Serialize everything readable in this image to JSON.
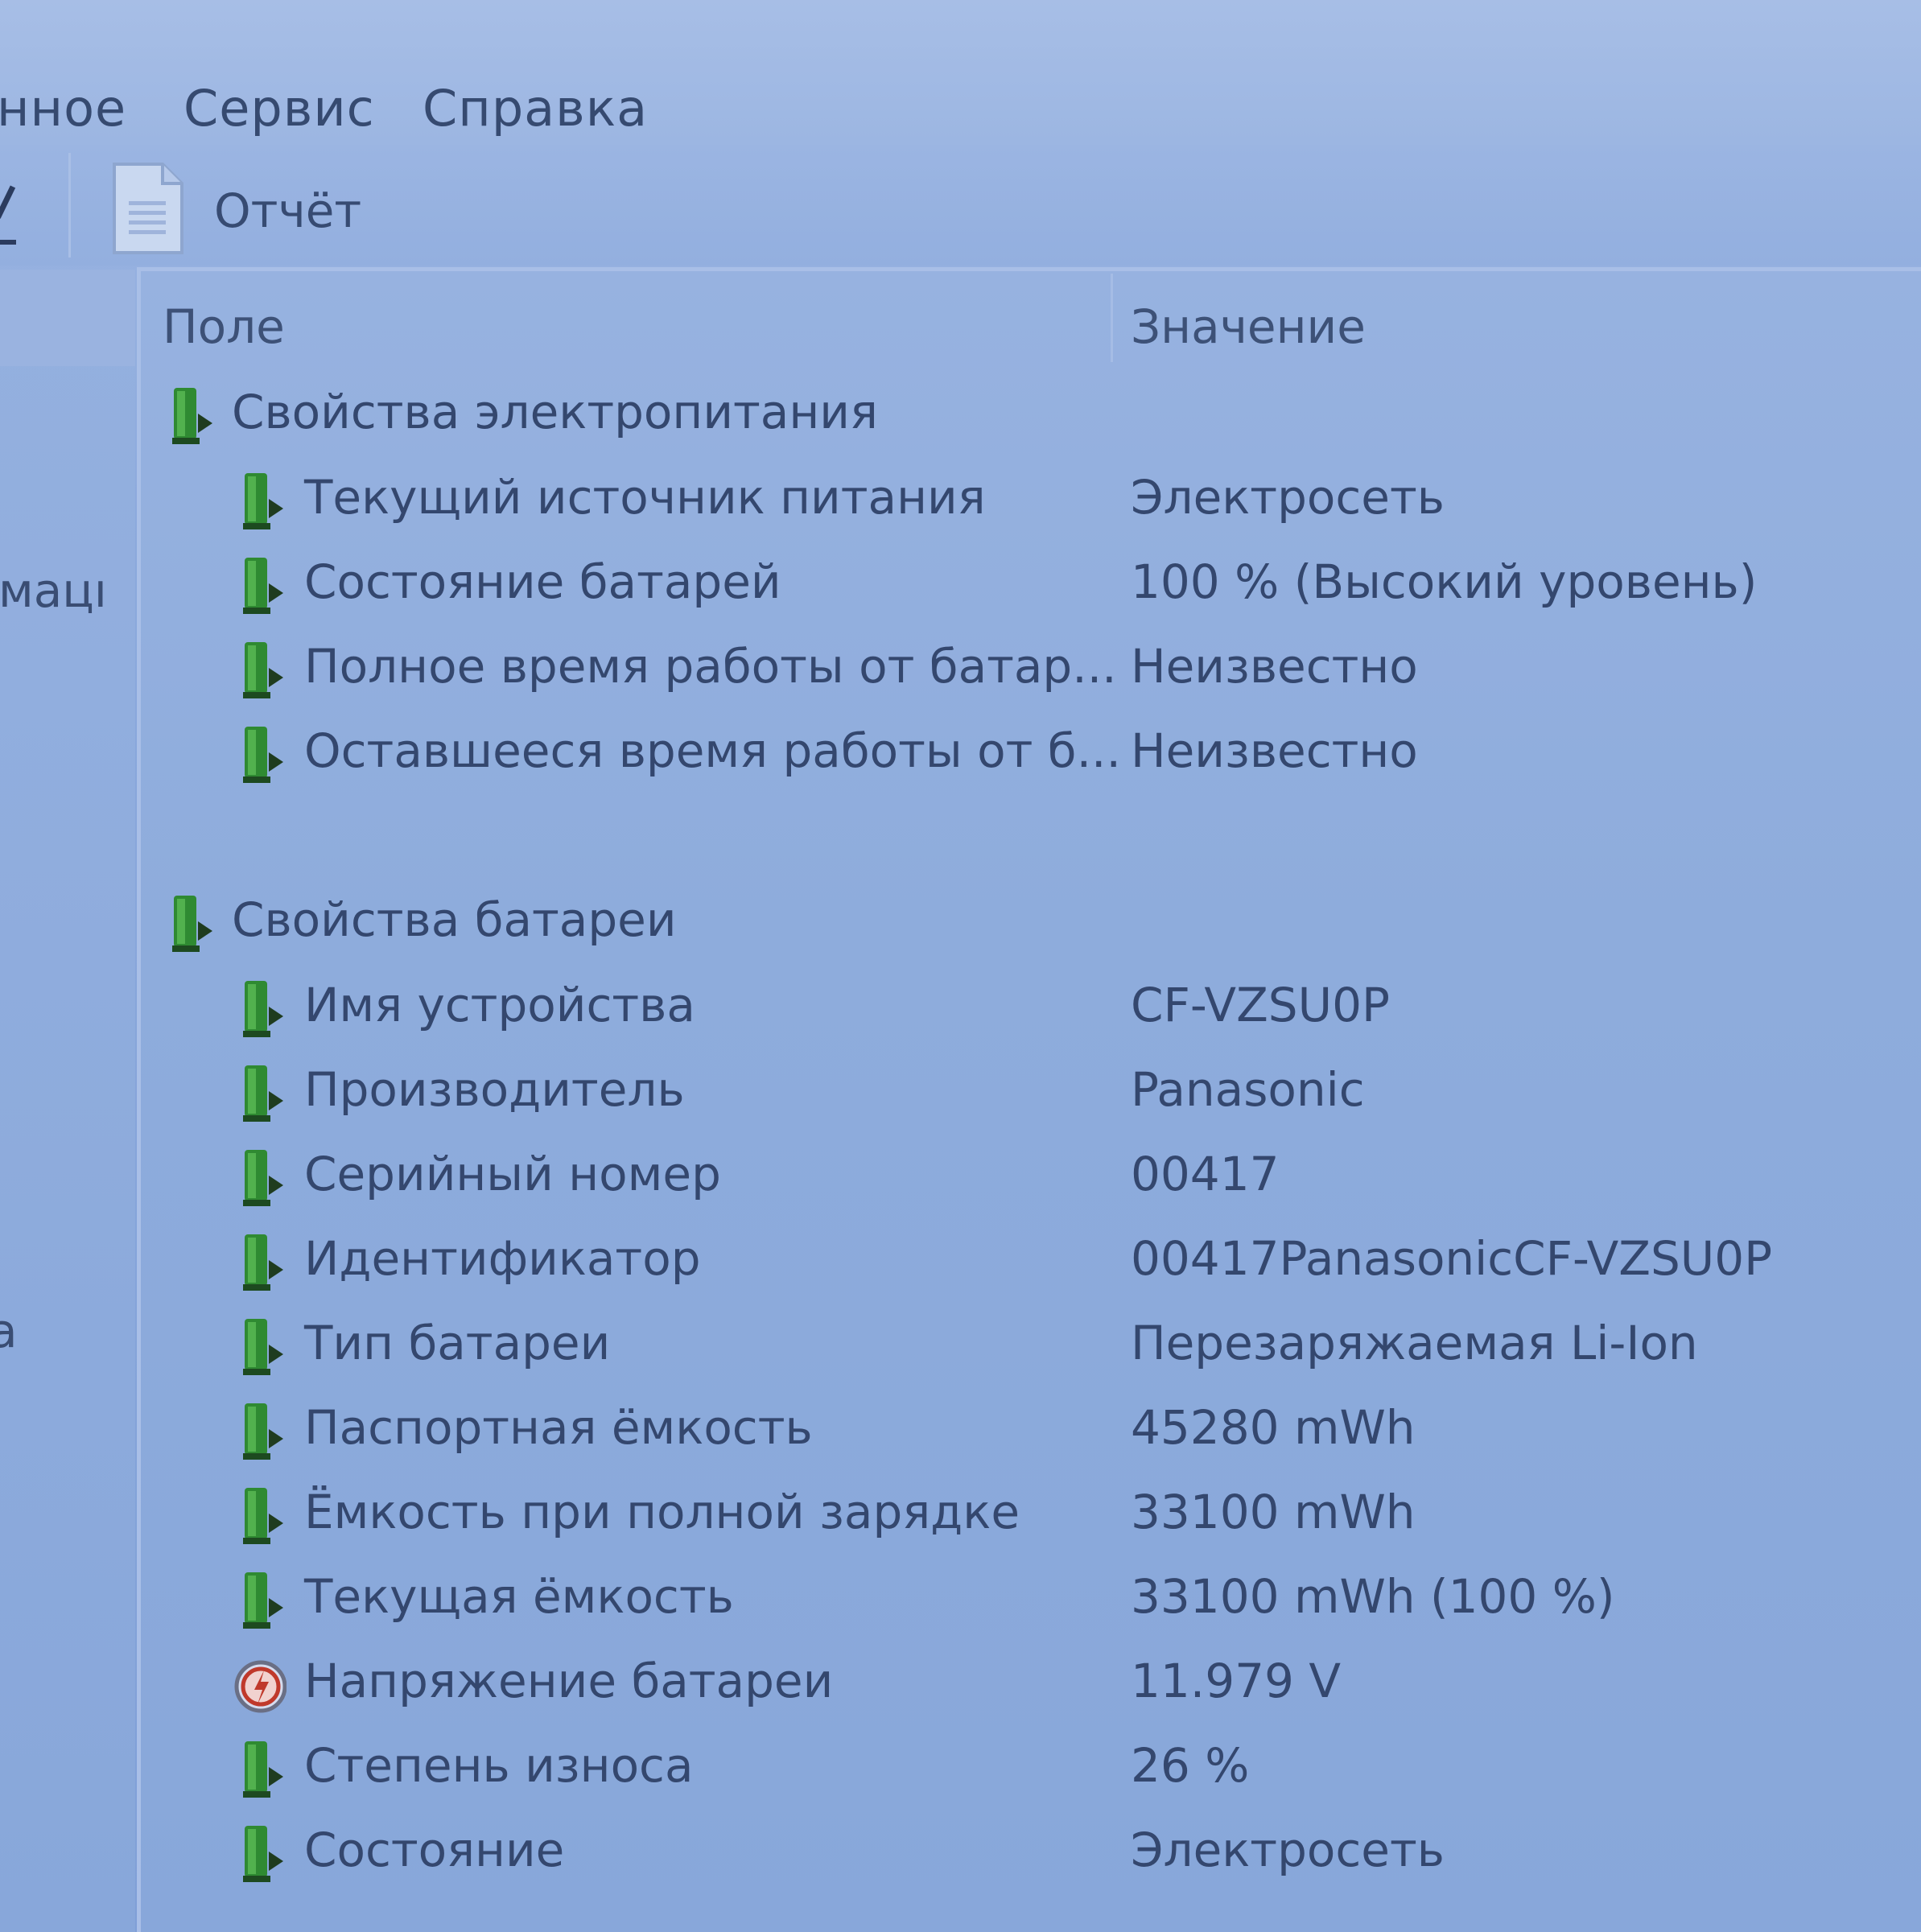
{
  "menu": {
    "items": [
      {
        "label": "нное"
      },
      {
        "label": "Сервис"
      },
      {
        "label": "Справка"
      }
    ]
  },
  "toolbar": {
    "report_label": "Отчёт"
  },
  "left_pane": {
    "fragments": [
      "мацı",
      "а"
    ]
  },
  "table": {
    "headers": {
      "field": "Поле",
      "value": "Значение"
    },
    "groups": [
      {
        "label": "Свойства электропитания",
        "icon": "battery-icon",
        "rows": [
          {
            "field": "Текущий источник питания",
            "value": "Электросеть",
            "icon": "battery-icon"
          },
          {
            "field": "Состояние батарей",
            "value": "100 % (Высокий уровень)",
            "icon": "battery-icon"
          },
          {
            "field": "Полное время работы от батар...",
            "value": "Неизвестно",
            "icon": "battery-icon"
          },
          {
            "field": "Оставшееся время работы от б...",
            "value": "Неизвестно",
            "icon": "battery-icon"
          }
        ]
      },
      {
        "label": "Свойства батареи",
        "icon": "battery-icon",
        "rows": [
          {
            "field": "Имя устройства",
            "value": "CF-VZSU0P",
            "icon": "battery-icon"
          },
          {
            "field": "Производитель",
            "value": "Panasonic",
            "icon": "battery-icon"
          },
          {
            "field": "Серийный номер",
            "value": "00417",
            "icon": "battery-icon"
          },
          {
            "field": "Идентификатор",
            "value": "00417PanasonicCF-VZSU0P",
            "icon": "battery-icon"
          },
          {
            "field": "Тип батареи",
            "value": "Перезаряжаемая Li-Ion",
            "icon": "battery-icon"
          },
          {
            "field": "Паспортная ёмкость",
            "value": "45280 mWh",
            "icon": "battery-icon"
          },
          {
            "field": "Ёмкость при полной зарядке",
            "value": "33100 mWh",
            "icon": "battery-icon"
          },
          {
            "field": "Текущая ёмкость",
            "value": "33100 mWh  (100 %)",
            "icon": "battery-icon"
          },
          {
            "field": "Напряжение батареи",
            "value": "11.979 V",
            "icon": "voltage-icon"
          },
          {
            "field": "Степень износа",
            "value": "26 %",
            "icon": "battery-icon"
          },
          {
            "field": "Состояние",
            "value": "Электросеть",
            "icon": "battery-icon"
          }
        ]
      }
    ]
  },
  "colors": {
    "battery_green": "#2f8a32",
    "voltage_red": "#c0392b",
    "background": "#8eaddc"
  }
}
